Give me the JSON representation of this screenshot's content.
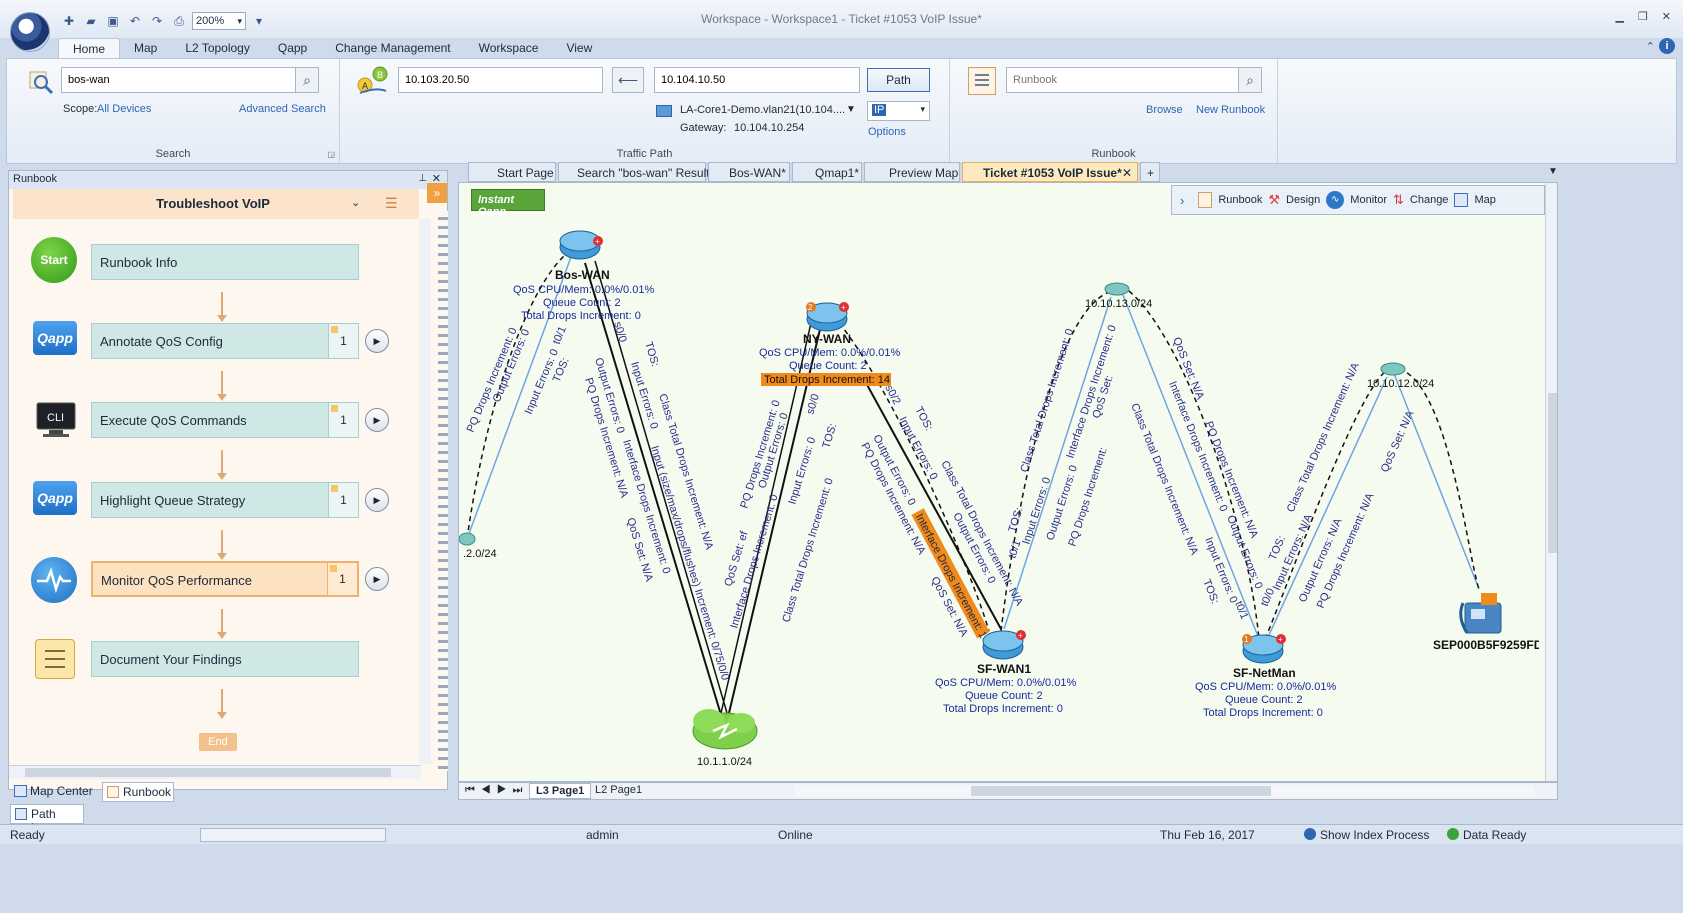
{
  "window": {
    "title": "Workspace - Workspace1 - Ticket #1053 VoIP Issue*",
    "zoom": "200%"
  },
  "ribbon_tabs": [
    "Home",
    "Map",
    "L2 Topology",
    "Qapp",
    "Change Management",
    "Workspace",
    "View"
  ],
  "search": {
    "value": "bos-wan",
    "scope_label": "Scope:",
    "scope_value": "All Devices",
    "advanced": "Advanced Search",
    "group_label": "Search"
  },
  "traffic_path": {
    "source": "10.103.20.50",
    "destination": "10.104.10.50",
    "path_button": "Path",
    "device": "LA-Core1-Demo.vlan21(10.104....",
    "protocol": "IP",
    "gateway_label": "Gateway:",
    "gateway_value": "10.104.10.254",
    "options": "Options",
    "group_label": "Traffic Path"
  },
  "runbook_group": {
    "placeholder": "Runbook",
    "browse": "Browse",
    "new_runbook": "New Runbook",
    "group_label": "Runbook"
  },
  "left_panel": {
    "header": "Runbook",
    "runbook_title": "Troubleshoot VoIP",
    "start_label": "Start",
    "end_label": "End",
    "steps": [
      {
        "label": "Runbook Info",
        "count": ""
      },
      {
        "label": "Annotate QoS Config",
        "count": "1"
      },
      {
        "label": "Execute QoS Commands",
        "count": "1"
      },
      {
        "label": "Highlight Queue Strategy",
        "count": "1"
      },
      {
        "label": "Monitor QoS Performance",
        "count": "1"
      },
      {
        "label": "Document Your Findings",
        "count": ""
      }
    ],
    "bottom_tabs": [
      "Map Center",
      "Runbook"
    ],
    "path_log": "Path Log"
  },
  "doc_tabs": [
    "Start Page",
    "Search \"bos-wan\" Result",
    "Bos-WAN*",
    "Qmap1*",
    "Preview Map",
    "Ticket #1053 VoIP Issue*"
  ],
  "map_toolbar": {
    "items": [
      "Runbook",
      "Design",
      "Monitor",
      "Change",
      "Map"
    ],
    "instant_qapp": "Instant Qapp"
  },
  "map": {
    "devices": {
      "bos_wan": {
        "name": "Bos-WAN",
        "lines": [
          "QoS CPU/Mem: 0.0%/0.01%",
          "Queue Count: 2",
          "Total Drops Increment: 0"
        ]
      },
      "ny_wan": {
        "name": "NY-WAN",
        "lines": [
          "QoS CPU/Mem: 0.0%/0.01%",
          "Queue Count: 2"
        ],
        "alert": "Total Drops Increment: 14",
        "badge": "2"
      },
      "sf_wan1": {
        "name": "SF-WAN1",
        "lines": [
          "QoS CPU/Mem: 0.0%/0.01%",
          "Queue Count: 2",
          "Total Drops Increment: 0"
        ]
      },
      "sf_netman": {
        "name": "SF-NetMan",
        "lines": [
          "QoS CPU/Mem: 0.0%/0.01%",
          "Queue Count: 2",
          "Total Drops Increment: 0"
        ],
        "badge": "1"
      },
      "phone": {
        "name": "SEP000B5F9259FD"
      }
    },
    "subnets": {
      "s1": "10.1.1.0/24",
      "s13": "10.10.13.0/24",
      "s12": "10.10.12.0/24",
      "s2": ".2.0/24"
    },
    "link_labels": {
      "a1": "PQ Drops Increment: 0",
      "a2": "Output Errors: 0",
      "a3": "Input Errors: 0",
      "a4": "TOS:",
      "a5": "t0/1",
      "b1": "s0/0",
      "b2": "TOS:",
      "b3": "Output Errors: 0",
      "b4": "Input Errors: 0",
      "b5": "PQ Drops Increment: N/A",
      "b6": "Interface Drops Increment: 0",
      "b7": "Class Total Drops Increment: N/A",
      "b8": "Input (size/max/drops/flushes) Increment: 0/75/0/0",
      "b9": "QoS Set: N/A",
      "c1": "PQ Drops Increment: 0",
      "c2": "Output Errors: 0",
      "c3": "s0/0",
      "c4": "TOS:",
      "c5": "QoS Set: ef",
      "c6": "Interface Drops Increment: 0",
      "c7": "Input Errors: 0",
      "c8": "Class Total Drops Increment: 0",
      "d1": "s0/2",
      "d2": "TOS:",
      "d3": "Output Errors: 0",
      "d4": "Input Errors: 0",
      "d5": "PQ Drops Increment: N/A",
      "d6": "Interface Drops Increment: 14",
      "d7": "Class Total Drops Increment: N/A",
      "d8": "Output Errors: 0",
      "d9": "QoS Set: N/A",
      "e1": "Class Total Drops Increment: 0",
      "e2": "Input Errors: 0",
      "e3": "Interface Drops Increment: 0",
      "e4": "TOS:",
      "e5": "Output Errors: 0",
      "e6": "QoS Set:",
      "e7": "PQ Drops Increment:",
      "e8": "t0/1",
      "f1": "QoS Set: N/A",
      "f2": "Class Total Drops Increment: N/A",
      "f3": "Interface Drops Increment: 0",
      "f4": "PQ Drops Increment: N/A",
      "f5": "Input Errors: 0",
      "f6": "Output Errors: 0",
      "f7": "TOS:",
      "f8": "t0/1",
      "g1": "t0/0",
      "g2": "TOS:",
      "g3": "Class Total Drops Increment: N/A",
      "g4": "Input Errors: N/A",
      "g5": "Output Errors: N/A",
      "g6": "PQ Drops Increment: N/A",
      "h1": "QoS Set: N/A"
    }
  },
  "page_tabs": [
    "L3 Page1",
    "L2 Page1"
  ],
  "status": {
    "ready": "Ready",
    "user": "admin",
    "online": "Online",
    "date": "Thu Feb 16, 2017",
    "index": "Show Index Process",
    "data": "Data Ready"
  },
  "colors": {
    "accent": "#2e66b3",
    "alert": "#f08a1c",
    "runbook_step": "#cfe8e6",
    "active_step": "#fde2c1"
  }
}
